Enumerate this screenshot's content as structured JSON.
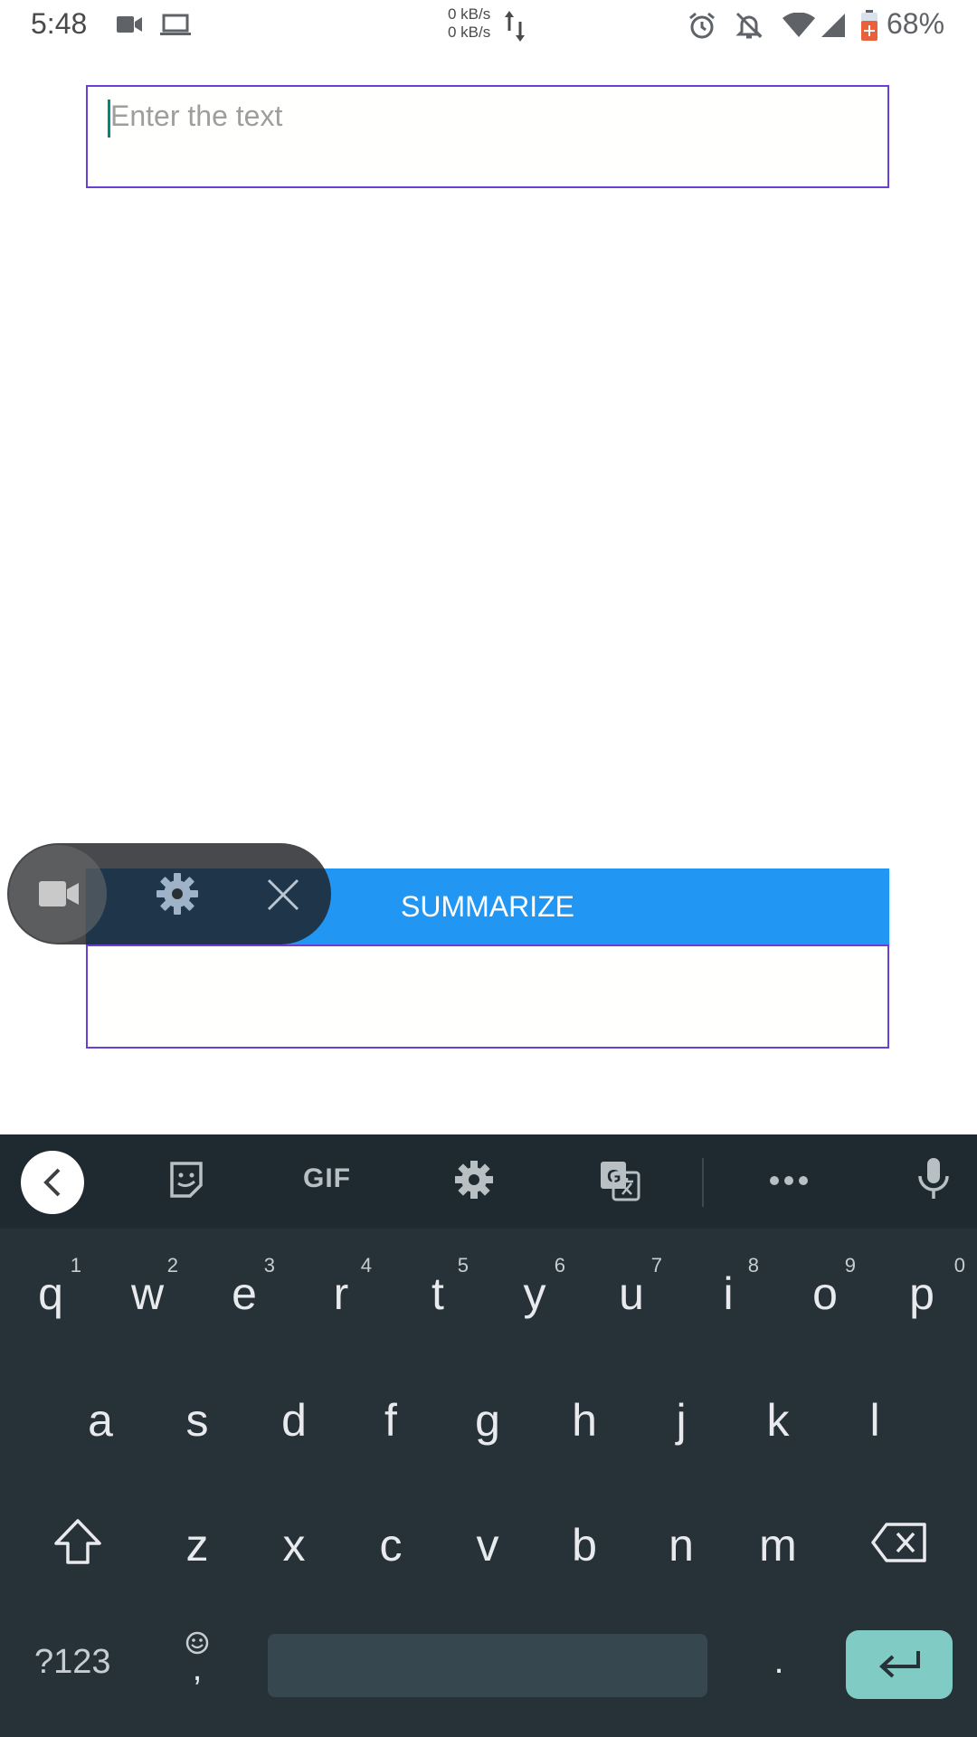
{
  "status_bar": {
    "time": "5:48",
    "net_up": "0 kB/s",
    "net_down": "0 kB/s",
    "battery": "68%",
    "icons": [
      "video-camera-icon",
      "laptop-icon",
      "data-arrows-icon",
      "alarm-icon",
      "bell-off-icon",
      "wifi-icon",
      "signal-icon",
      "battery-icon"
    ]
  },
  "input": {
    "placeholder": "Enter the text"
  },
  "summarize": {
    "label": "SUMMARIZE"
  },
  "keyboard": {
    "toolbar_gif": "GIF",
    "row1": [
      "q",
      "w",
      "e",
      "r",
      "t",
      "y",
      "u",
      "i",
      "o",
      "p"
    ],
    "row1_hints": [
      "1",
      "2",
      "3",
      "4",
      "5",
      "6",
      "7",
      "8",
      "9",
      "0"
    ],
    "row2": [
      "a",
      "s",
      "d",
      "f",
      "g",
      "h",
      "j",
      "k",
      "l"
    ],
    "row3": [
      "z",
      "x",
      "c",
      "v",
      "b",
      "n",
      "m"
    ],
    "sym_label": "?123",
    "comma": ",",
    "period": "."
  },
  "colors": {
    "accent": "#2196f3",
    "border": "#6a3fd6",
    "keyboard_bg": "#263238",
    "enter_key": "#80cbc4"
  }
}
